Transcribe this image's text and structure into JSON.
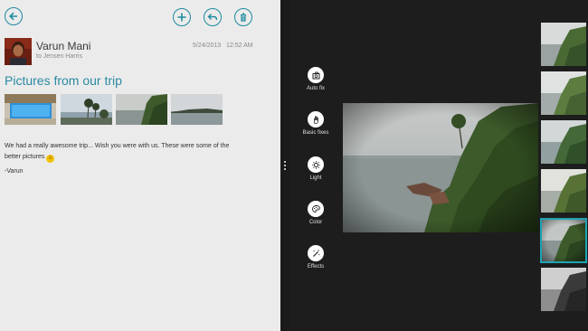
{
  "mail": {
    "sender_name": "Varun Mani",
    "to_line": "to  Jensen Harris",
    "date": "5/24/2013",
    "time": "12:52 AM",
    "subject": "Pictures from our trip",
    "body": "We had a really awesome trip... Wish you were with us. These were some of the better pictures",
    "smiley": "☺",
    "signoff": "-Varun",
    "toolbar_icons": [
      "back-arrow-icon",
      "plus-icon",
      "reply-icon",
      "trash-icon"
    ]
  },
  "photos": {
    "tools": [
      {
        "label": "Auto fix",
        "icon": "auto-fix-icon"
      },
      {
        "label": "Basic fixes",
        "icon": "basic-fixes-icon"
      },
      {
        "label": "Light",
        "icon": "light-icon"
      },
      {
        "label": "Color",
        "icon": "color-icon"
      },
      {
        "label": "Effects",
        "icon": "effects-icon"
      }
    ],
    "filmstrip_selected_index": 4,
    "accent_color": "#1fa3b3"
  },
  "colors": {
    "mail_accent": "#2a8aa3",
    "mail_bg": "#ebebeb",
    "photos_bg": "#1d1d1d"
  }
}
